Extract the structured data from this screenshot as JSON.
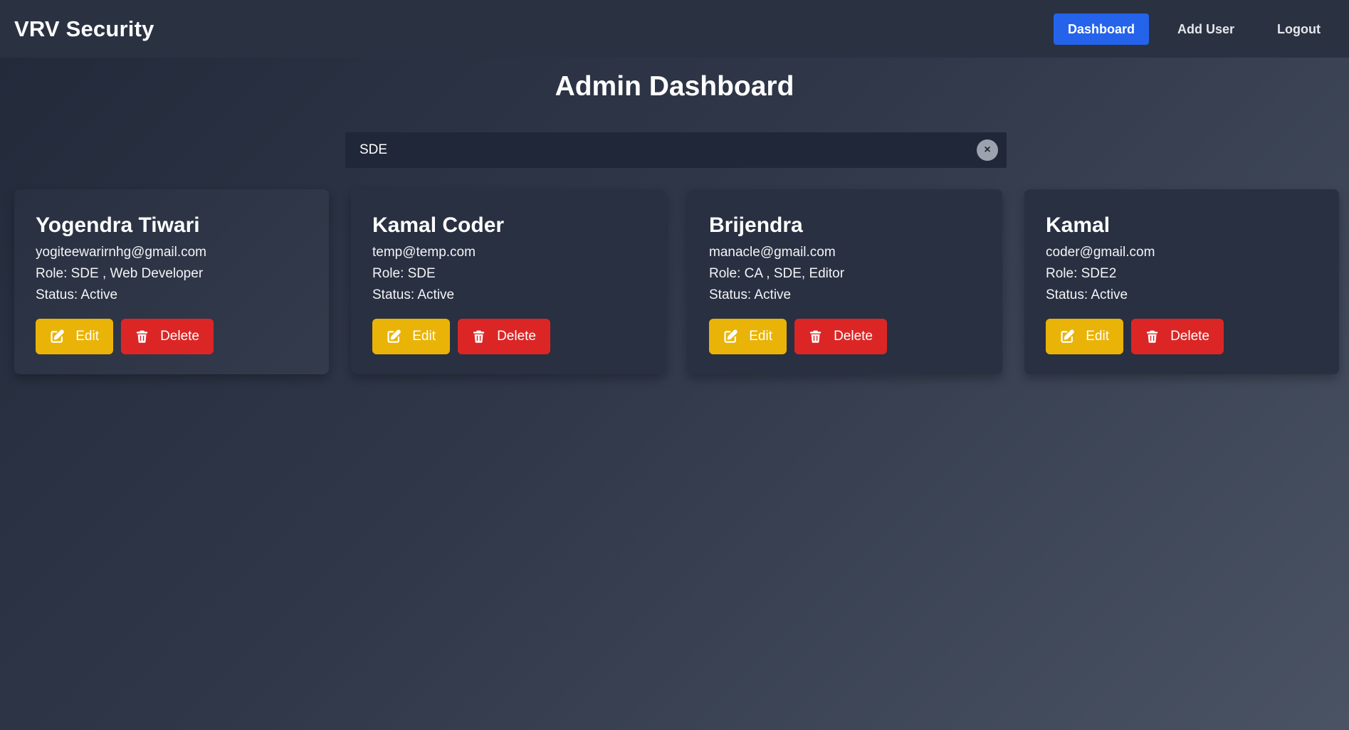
{
  "navbar": {
    "brand": "VRV Security",
    "links": [
      {
        "label": "Dashboard",
        "active": true
      },
      {
        "label": "Add User",
        "active": false
      },
      {
        "label": "Logout",
        "active": false
      }
    ]
  },
  "page": {
    "title": "Admin Dashboard"
  },
  "search": {
    "value": "SDE",
    "clear_label": "×"
  },
  "users": [
    {
      "name": "Yogendra Tiwari",
      "email": "yogiteewarirnhg@gmail.com",
      "role": "Role: SDE , Web Developer",
      "status": "Status: Active",
      "edit_label": "Edit",
      "delete_label": "Delete"
    },
    {
      "name": "Kamal Coder",
      "email": "temp@temp.com",
      "role": "Role: SDE",
      "status": "Status: Active",
      "edit_label": "Edit",
      "delete_label": "Delete"
    },
    {
      "name": "Brijendra",
      "email": "manacle@gmail.com",
      "role": "Role: CA , SDE, Editor",
      "status": "Status: Active",
      "edit_label": "Edit",
      "delete_label": "Delete"
    },
    {
      "name": "Kamal",
      "email": "coder@gmail.com",
      "role": "Role: SDE2",
      "status": "Status: Active",
      "edit_label": "Edit",
      "delete_label": "Delete"
    }
  ],
  "colors": {
    "accent": "#2563eb",
    "edit": "#eab308",
    "delete": "#dc2626"
  },
  "icons": {
    "edit": "edit-icon",
    "delete": "trash-icon"
  }
}
